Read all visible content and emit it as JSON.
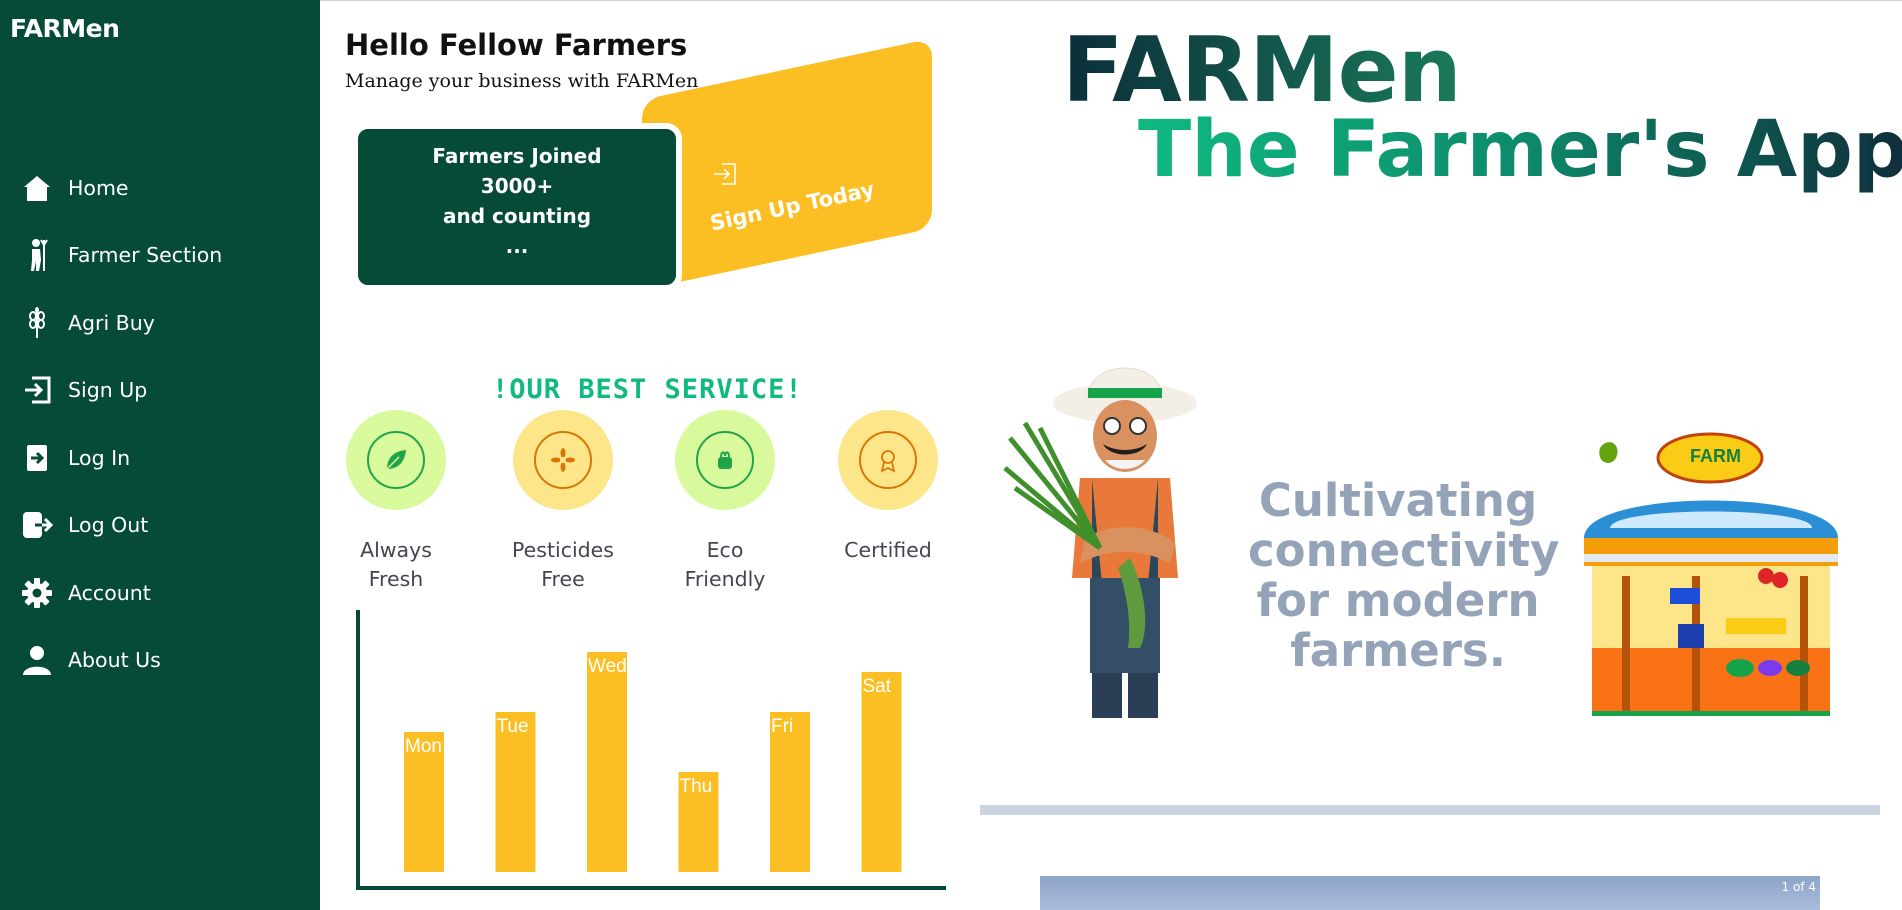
{
  "app": {
    "brand": "FARMen"
  },
  "sidebar": {
    "items": [
      {
        "label": "Home",
        "icon": "home-icon"
      },
      {
        "label": "Farmer Section",
        "icon": "farmer-icon"
      },
      {
        "label": "Agri Buy",
        "icon": "wheat-icon"
      },
      {
        "label": "Sign Up",
        "icon": "sign-in-icon"
      },
      {
        "label": "Log In",
        "icon": "login-icon"
      },
      {
        "label": "Log Out",
        "icon": "logout-icon"
      },
      {
        "label": "Account",
        "icon": "gear-icon"
      },
      {
        "label": "About Us",
        "icon": "user-icon"
      }
    ]
  },
  "header": {
    "greeting": "Hello Fellow Farmers",
    "subtitle": "Manage your business with FARMen"
  },
  "stats_card": {
    "line1": "Farmers Joined",
    "line2": "3000+",
    "line3": "and counting",
    "line4": "..."
  },
  "signup_card": {
    "label": "Sign Up Today",
    "icon": "sign-in-icon"
  },
  "services": {
    "title": "!OUR BEST SERVICE!",
    "items": [
      {
        "line1": "Always",
        "line2": "Fresh",
        "icon": "leaf-icon"
      },
      {
        "line1": "Pesticides",
        "line2": "Free",
        "icon": "flower-icon"
      },
      {
        "line1": "Eco",
        "line2": "Friendly",
        "icon": "eco-icon"
      },
      {
        "line1": "Certified",
        "line2": "",
        "icon": "badge-icon"
      }
    ]
  },
  "hero": {
    "title": "FARMen",
    "subtitle": "The Farmer's App",
    "tagline": "Cultivating connectivity for modern farmers.",
    "store_sign": "FARM"
  },
  "carousel": {
    "counter": "1 of 4"
  },
  "colors": {
    "sidebar": "#064a38",
    "accent_yellow": "#fbbf24",
    "accent_green": "#10b981",
    "tagline": "#94a3b8"
  },
  "chart_data": {
    "type": "bar",
    "categories": [
      "Mon",
      "Tue",
      "Wed",
      "Thu",
      "Fri",
      "Sat"
    ],
    "values": [
      140,
      160,
      220,
      100,
      160,
      200
    ],
    "ylim": [
      0,
      240
    ],
    "grid": false,
    "title": "",
    "xlabel": "",
    "ylabel": ""
  }
}
